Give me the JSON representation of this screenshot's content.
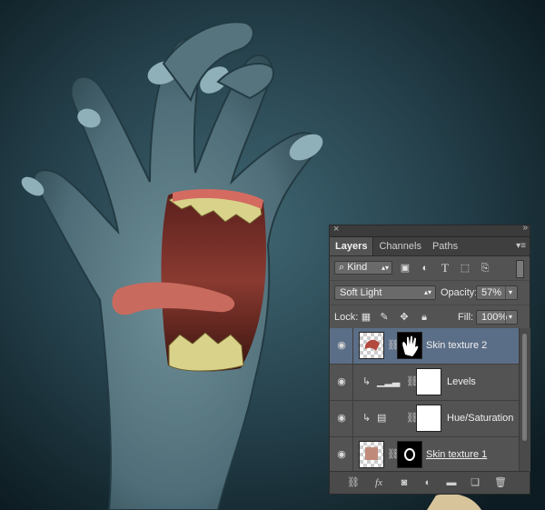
{
  "panel": {
    "close_glyph": "×",
    "collapse_glyph": "»",
    "tabs": [
      {
        "label": "Layers",
        "active": true
      },
      {
        "label": "Channels",
        "active": false
      },
      {
        "label": "Paths",
        "active": false
      }
    ],
    "menu_icon": "panel-menu-icon"
  },
  "filter": {
    "kind_label": "Kind",
    "icons": [
      "pixel-filter-icon",
      "adjustment-filter-icon",
      "type-filter-icon",
      "shape-filter-icon",
      "smart-object-filter-icon"
    ]
  },
  "blend": {
    "mode": "Soft Light",
    "opacity_label": "Opacity:",
    "opacity_value": "57%"
  },
  "lock": {
    "label": "Lock:",
    "fill_label": "Fill:",
    "fill_value": "100%"
  },
  "layers": [
    {
      "name": "Skin texture 2",
      "selected": true,
      "type": "pixel-with-mask",
      "clipped": false,
      "visible": true
    },
    {
      "name": "Levels",
      "selected": false,
      "type": "levels-adjustment",
      "clipped": true,
      "visible": true
    },
    {
      "name": "Hue/Saturation",
      "selected": false,
      "type": "hue-saturation-adjustment",
      "clipped": true,
      "visible": true
    },
    {
      "name": "Skin texture 1",
      "selected": false,
      "type": "pixel-with-mask",
      "clipped": false,
      "visible": true
    }
  ],
  "bottom_icons": [
    "link-layers-icon",
    "fx-icon",
    "add-mask-icon",
    "new-adjustment-icon",
    "new-group-icon",
    "new-layer-icon",
    "trash-icon"
  ],
  "bottom_labels": {
    "fx": "fx"
  },
  "colors": {
    "panel_bg": "#535353",
    "selected_row": "#5b6e87",
    "background_teal": "#2d4752"
  }
}
